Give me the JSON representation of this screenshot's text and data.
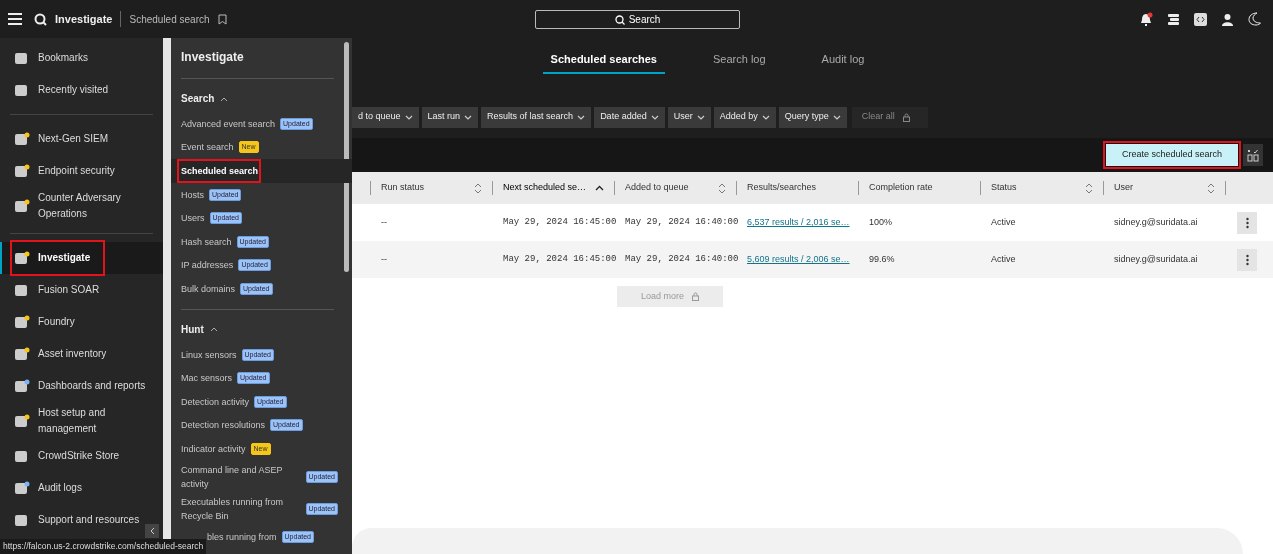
{
  "top_bar": {
    "app_title": "Investigate",
    "page_title": "Scheduled search",
    "search_placeholder": "Search",
    "notification_dot": true
  },
  "nav": {
    "groups": [
      [
        {
          "label": "Bookmarks",
          "selected": false,
          "highlighted": false
        },
        {
          "label": "Recently visited",
          "selected": false,
          "highlighted": false
        }
      ],
      [
        {
          "label": "Next-Gen SIEM",
          "selected": false,
          "highlighted": false,
          "color": "#f5c518"
        },
        {
          "label": "Endpoint security",
          "selected": false,
          "highlighted": false,
          "color": "#f5c518"
        },
        {
          "label": "Counter Adversary Operations",
          "selected": false,
          "highlighted": false,
          "color": "#f5c518"
        }
      ],
      [
        {
          "label": "Investigate",
          "selected": true,
          "highlighted": true,
          "color": "#f5c518"
        },
        {
          "label": "Fusion SOAR",
          "selected": false,
          "highlighted": false
        },
        {
          "label": "Foundry",
          "selected": false,
          "highlighted": false,
          "color": "#f5c518"
        },
        {
          "label": "Asset inventory",
          "selected": false,
          "highlighted": false,
          "color": "#f5c518"
        },
        {
          "label": "Dashboards and reports",
          "selected": false,
          "highlighted": false,
          "color": "#7fb2f0"
        },
        {
          "label": "Host setup and management",
          "selected": false,
          "highlighted": false,
          "color": "#f5c518"
        },
        {
          "label": "CrowdStrike Store",
          "selected": false,
          "highlighted": false
        },
        {
          "label": "Audit logs",
          "selected": false,
          "highlighted": false,
          "color": "#7fb2f0"
        },
        {
          "label": "Support and resources",
          "selected": false,
          "highlighted": false
        }
      ]
    ]
  },
  "flyout": {
    "title": "Investigate",
    "sections": [
      {
        "label": "Search",
        "expanded": true,
        "items": [
          {
            "label": "Advanced event search",
            "selected": false,
            "highlighted": false,
            "badge": {
              "label": "Updated",
              "kind": "updated"
            }
          },
          {
            "label": "Event search",
            "selected": false,
            "highlighted": false,
            "badge": {
              "label": "New",
              "kind": "new"
            }
          },
          {
            "label": "Scheduled search",
            "selected": true,
            "highlighted": true
          },
          {
            "label": "Hosts",
            "selected": false,
            "highlighted": false,
            "badge": {
              "label": "Updated",
              "kind": "updated"
            }
          },
          {
            "label": "Users",
            "selected": false,
            "highlighted": false,
            "badge": {
              "label": "Updated",
              "kind": "updated"
            }
          },
          {
            "label": "Hash search",
            "selected": false,
            "highlighted": false,
            "badge": {
              "label": "Updated",
              "kind": "updated"
            }
          },
          {
            "label": "IP addresses",
            "selected": false,
            "highlighted": false,
            "badge": {
              "label": "Updated",
              "kind": "updated"
            }
          },
          {
            "label": "Bulk domains",
            "selected": false,
            "highlighted": false,
            "badge": {
              "label": "Updated",
              "kind": "updated"
            }
          }
        ]
      },
      {
        "label": "Hunt",
        "expanded": true,
        "items": [
          {
            "label": "Linux sensors",
            "selected": false,
            "highlighted": false,
            "badge": {
              "label": "Updated",
              "kind": "updated"
            }
          },
          {
            "label": "Mac sensors",
            "selected": false,
            "highlighted": false,
            "badge": {
              "label": "Updated",
              "kind": "updated"
            }
          },
          {
            "label": "Detection activity",
            "selected": false,
            "highlighted": false,
            "badge": {
              "label": "Updated",
              "kind": "updated"
            }
          },
          {
            "label": "Detection resolutions",
            "selected": false,
            "highlighted": false,
            "badge": {
              "label": "Updated",
              "kind": "updated"
            }
          },
          {
            "label": "Indicator activity",
            "selected": false,
            "highlighted": false,
            "badge": {
              "label": "New",
              "kind": "new"
            }
          },
          {
            "label": "Command line and ASEP activity",
            "selected": false,
            "highlighted": false,
            "badge": {
              "label": "Updated",
              "kind": "updated"
            }
          },
          {
            "label": "Executables running from Recycle Bin",
            "selected": false,
            "highlighted": false,
            "badge": {
              "label": "Updated",
              "kind": "updated"
            }
          },
          {
            "label": "bles running from",
            "selected": false,
            "highlighted": false,
            "covered": true,
            "badge": {
              "label": "Updated",
              "kind": "updated"
            }
          }
        ]
      }
    ]
  },
  "tabs": [
    {
      "label": "Scheduled searches",
      "selected": true
    },
    {
      "label": "Search log",
      "selected": false
    },
    {
      "label": "Audit log",
      "selected": false
    }
  ],
  "filters": [
    {
      "label": "d to queue",
      "kind": "dropdown"
    },
    {
      "label": "Last run",
      "kind": "dropdown"
    },
    {
      "label": "Results of last search",
      "kind": "dropdown"
    },
    {
      "label": "Date added",
      "kind": "dropdown"
    },
    {
      "label": "User",
      "kind": "dropdown"
    },
    {
      "label": "Added by",
      "kind": "dropdown"
    },
    {
      "label": "Query type",
      "kind": "dropdown"
    },
    {
      "label": "Clear all",
      "kind": "clear"
    }
  ],
  "create_button": {
    "label": "Create scheduled search",
    "highlighted": true
  },
  "table": {
    "columns": [
      {
        "label": "Run status",
        "sortable": true,
        "sorted": false,
        "kind": "text"
      },
      {
        "label": "Next scheduled se…",
        "sortable": true,
        "sorted": true,
        "kind": "mono"
      },
      {
        "label": "Added to queue",
        "sortable": true,
        "sorted": false,
        "kind": "mono"
      },
      {
        "label": "Results/searches",
        "sortable": false,
        "sorted": false,
        "kind": "link"
      },
      {
        "label": "Completion rate",
        "sortable": false,
        "sorted": false,
        "kind": "text"
      },
      {
        "label": "Status",
        "sortable": true,
        "sorted": false,
        "kind": "text"
      },
      {
        "label": "User",
        "sortable": true,
        "sorted": false,
        "kind": "text"
      }
    ],
    "rows": [
      [
        "--",
        "May 29, 2024 16:45:00",
        "May 29, 2024 16:40:00",
        "6,537 results / 2,016 se…",
        "100%",
        "Active",
        "sidney.g@suridata.ai"
      ],
      [
        "--",
        "May 29, 2024 16:45:00",
        "May 29, 2024 16:40:00",
        "5,609 results / 2,006 se…",
        "99.6%",
        "Active",
        "sidney.g@suridata.ai"
      ]
    ]
  },
  "load_more": {
    "label": "Load more"
  },
  "status_url": "https://falcon.us-2.crowdstrike.com/scheduled-search"
}
